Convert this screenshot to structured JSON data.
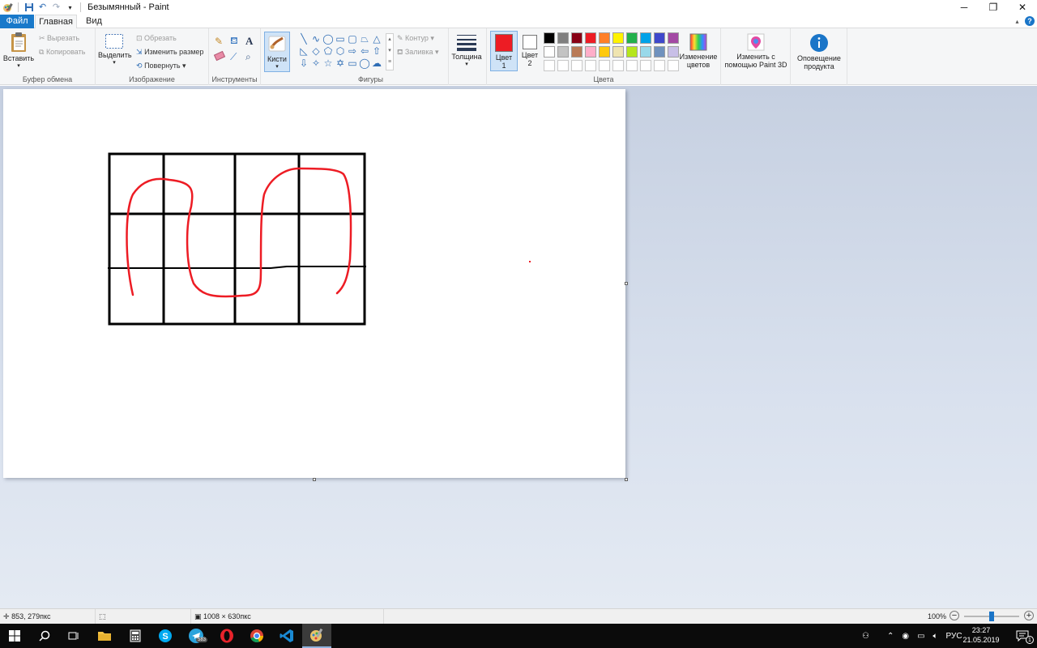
{
  "window": {
    "title": "Безымянный - Paint",
    "minimize": "─",
    "restore": "❐",
    "close": "✕"
  },
  "tabs": {
    "file": "Файл",
    "home": "Главная",
    "view": "Вид"
  },
  "ribbon": {
    "clipboard": {
      "label": "Буфер обмена",
      "paste": "Вставить",
      "cut": "Вырезать",
      "copy": "Копировать"
    },
    "image": {
      "label": "Изображение",
      "select": "Выделить",
      "crop": "Обрезать",
      "resize": "Изменить размер",
      "rotate": "Повернуть"
    },
    "tools": {
      "label": "Инструменты"
    },
    "brushes": {
      "label": "Кисти"
    },
    "shapes": {
      "label": "Фигуры",
      "outline": "Контур",
      "fill": "Заливка"
    },
    "size": {
      "label": "Толщина"
    },
    "colors": {
      "label": "Цвета",
      "color1_a": "Цвет",
      "color1_b": "1",
      "color2_a": "Цвет",
      "color2_b": "2",
      "color1_value": "#ed1c24",
      "color2_value": "#ffffff",
      "edit_a": "Изменение",
      "edit_b": "цветов",
      "palette_row1": [
        "#000000",
        "#7f7f7f",
        "#880015",
        "#ed1c24",
        "#ff7f27",
        "#fff200",
        "#22b14c",
        "#00a2e8",
        "#3f48cc",
        "#a349a4"
      ],
      "palette_row2": [
        "#ffffff",
        "#c3c3c3",
        "#b97a57",
        "#ffaec9",
        "#ffc90e",
        "#efe4b0",
        "#b5e61d",
        "#99d9ea",
        "#7092be",
        "#c8bfe7"
      ],
      "palette_row3": [
        "#ffffff",
        "#ffffff",
        "#ffffff",
        "#ffffff",
        "#ffffff",
        "#ffffff",
        "#ffffff",
        "#ffffff",
        "#ffffff",
        "#ffffff"
      ]
    },
    "paint3d": {
      "a": "Изменить с",
      "b": "помощью Paint 3D"
    },
    "product": {
      "a": "Оповещение",
      "b": "продукта"
    }
  },
  "statusbar": {
    "cursor_pos": "853, 279пкс",
    "image_size": "1008 × 630пкс",
    "zoom": "100%",
    "zoom_fraction": 0.5
  },
  "taskbar": {
    "telegram_badge": "583",
    "tray_lang": "РУС",
    "time": "23:27",
    "date": "21.05.2019",
    "notif_count": "1"
  }
}
